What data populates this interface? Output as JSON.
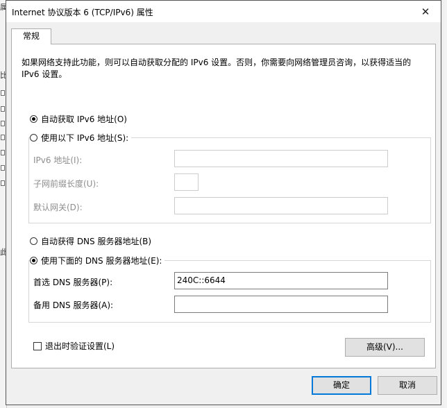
{
  "background": {
    "left_text_1": "属",
    "left_text_2": "比",
    "left_text_3": "此"
  },
  "window": {
    "title": "Internet 协议版本 6 (TCP/IPv6) 属性",
    "close_symbol": "✕"
  },
  "tabs": [
    {
      "label": "常规"
    }
  ],
  "description": "如果网络支持此功能，则可以自动获取分配的 IPv6 设置。否则，你需要向网络管理员咨询，以获得适当的 IPv6 设置。",
  "ip": {
    "auto_label": "自动获取 IPv6 地址(O)",
    "auto_checked": true,
    "manual_label": "使用以下 IPv6 地址(S):",
    "manual_checked": false,
    "address_label": "IPv6 地址(I):",
    "address_value": "",
    "prefix_label": "子网前缀长度(U):",
    "prefix_value": "",
    "gateway_label": "默认网关(D):",
    "gateway_value": ""
  },
  "dns": {
    "auto_label": "自动获得 DNS 服务器地址(B)",
    "auto_checked": false,
    "manual_label": "使用下面的 DNS 服务器地址(E):",
    "manual_checked": true,
    "preferred_label": "首选 DNS 服务器(P):",
    "preferred_value": "240C::6644",
    "alternate_label": "备用 DNS 服务器(A):",
    "alternate_value": ""
  },
  "validate_label": "退出时验证设置(L)",
  "validate_checked": false,
  "buttons": {
    "advanced": "高级(V)...",
    "ok": "确定",
    "cancel": "取消"
  }
}
